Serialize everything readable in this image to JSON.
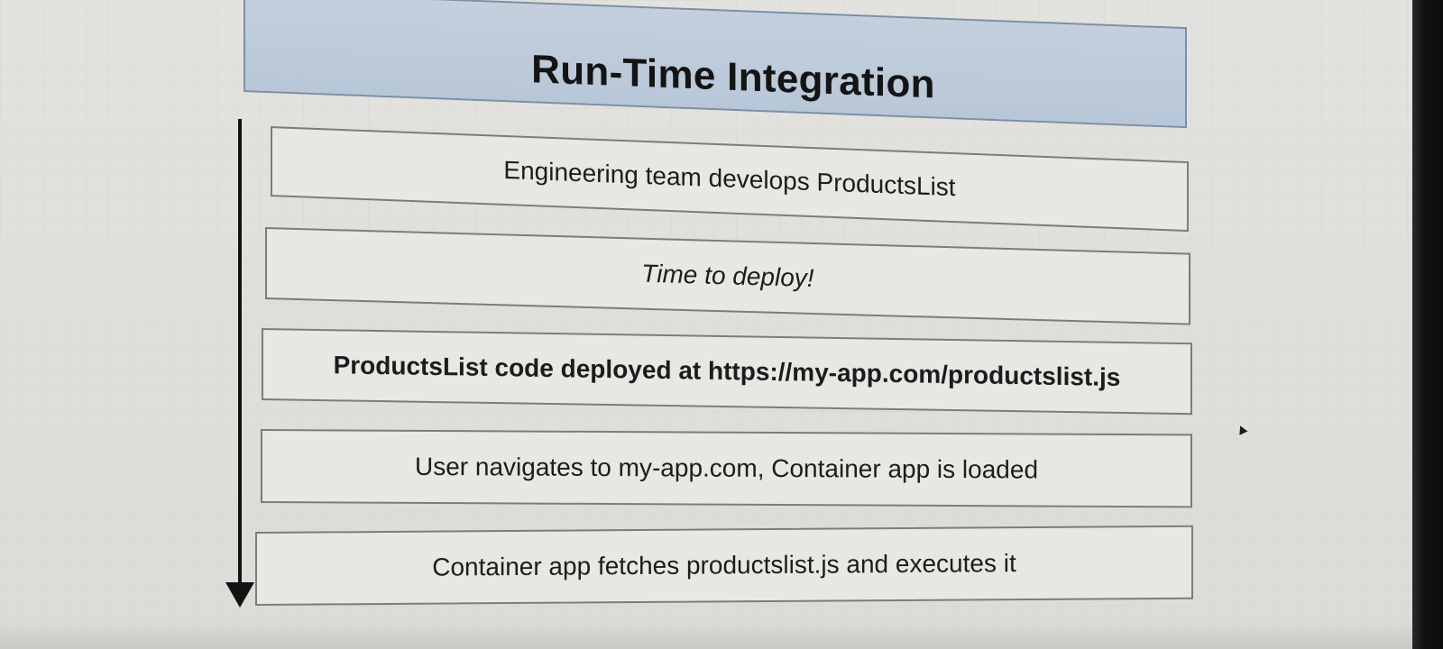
{
  "diagram": {
    "title": "Run-Time Integration",
    "steps": [
      {
        "label": "Engineering team develops ProductsList",
        "style": "normal"
      },
      {
        "label": "Time to deploy!",
        "style": "italic"
      },
      {
        "label": "ProductsList code deployed at https://my-app.com/productslist.js",
        "style": "bold"
      },
      {
        "label": "User navigates to my-app.com, Container app is loaded",
        "style": "normal"
      },
      {
        "label": "Container app fetches productslist.js and executes it",
        "style": "normal"
      }
    ],
    "colors": {
      "header_fill": "#b8c7d8",
      "step_fill": "#e8e7e3",
      "arrow": "#121212"
    }
  }
}
